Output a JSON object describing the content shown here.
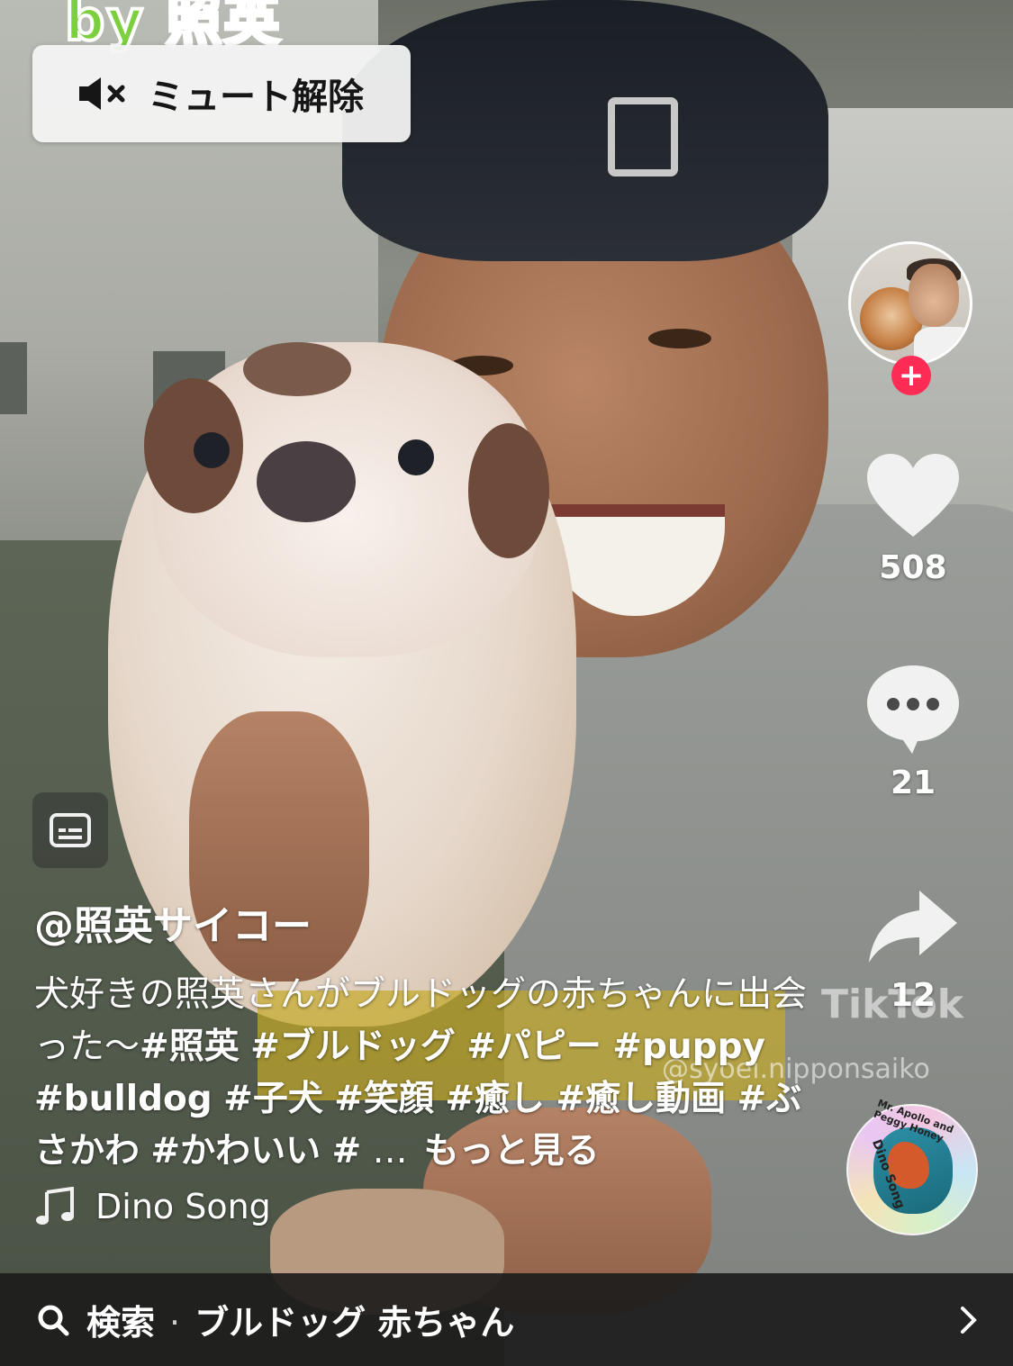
{
  "overlay": {
    "top_logo_text": "by 照英",
    "mute_label": "ミュート解除"
  },
  "watermark": {
    "brand": "TikTok",
    "handle": "@syoei.nipponsaiko"
  },
  "creator": {
    "username": "@照英サイコー",
    "follow_symbol": "+"
  },
  "actions": {
    "likes": "508",
    "comments": "21",
    "shares": "12"
  },
  "description": {
    "text_start": "犬好きの照英さんがブルドッグの赤ちゃんに出会った〜",
    "hashtags": [
      "#照英",
      "#ブルドッグ",
      "#パピー",
      "#puppy",
      "#bulldog",
      "#子犬",
      "#笑顔",
      "#癒し",
      "#癒し動画",
      "#ぶさかわ",
      "#かわいい",
      "#"
    ],
    "ellipsis": "…",
    "more_label": "もっと見る"
  },
  "music": {
    "title": "Dino Song",
    "disc_text_top": "Mr. Apollo and Peggy Honey",
    "disc_text_bottom": "Dino Song"
  },
  "search_bar": {
    "prefix": "検索",
    "separator": "·",
    "query": "ブルドッグ 赤ちゃん"
  },
  "colors": {
    "follow_accent": "#fe2c55",
    "bottom_bar": "#1c1c1c",
    "mute_bg": "#f4f4f4"
  }
}
